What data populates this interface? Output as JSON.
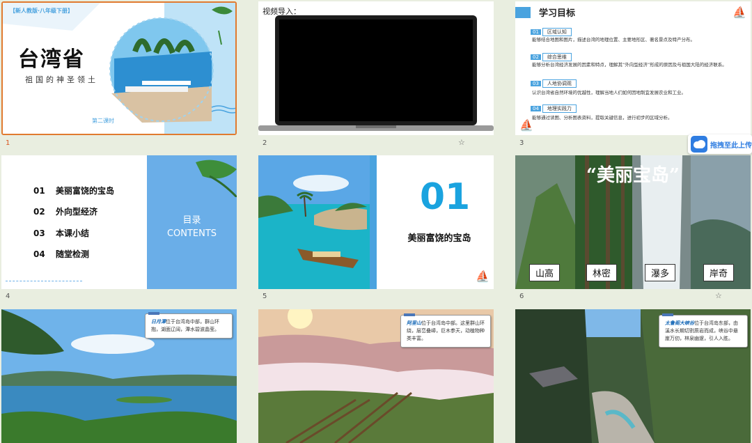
{
  "slides": [
    {
      "number": "1",
      "tag": "【新人教版·八年级下册】",
      "title": "台湾省",
      "subtitle": "祖国的神圣领土",
      "lesson": "第二课时"
    },
    {
      "number": "2",
      "label": "视频导入："
    },
    {
      "number": "3",
      "title": "学习目标",
      "items": [
        {
          "num": "01",
          "label": "区域认知",
          "desc": "能够结合地图和图片，描述台湾的地理位置、主要地形区、著名景点及特产分布。"
        },
        {
          "num": "02",
          "label": "综合思维",
          "desc": "能够分析台湾经济发展的因素和特点，理解其“外向型经济”形成的原因及与祖国大陆的经济联系。"
        },
        {
          "num": "03",
          "label": "人地协调观",
          "desc": "认识台湾省自然环境的优越性，理解当地人们如何因地制宜发展农业和工业。"
        },
        {
          "num": "04",
          "label": "地理实践力",
          "desc": "能够通过读图、分析图表资料，提取关键信息，进行初步的区域分析。"
        }
      ]
    },
    {
      "number": "4",
      "items": [
        {
          "num": "01",
          "label": "美丽富饶的宝岛"
        },
        {
          "num": "02",
          "label": "外向型经济"
        },
        {
          "num": "03",
          "label": "本课小结"
        },
        {
          "num": "04",
          "label": "随堂检测"
        }
      ],
      "toc_cn": "目录",
      "toc_en": "CONTENTS"
    },
    {
      "number": "5",
      "section_num": "01",
      "section_title": "美丽富饶的宝岛"
    },
    {
      "number": "6",
      "title": "“美丽宝岛”",
      "labels": [
        "山高",
        "林密",
        "瀑多",
        "岸奇"
      ]
    },
    {
      "number": "7",
      "caption_bold": "日月潭",
      "caption_rest": "位于台湾岛中部，群山环抱，湖面辽阔，潭水碧波晶莹。"
    },
    {
      "number": "8",
      "caption_bold": "阿里山",
      "caption_rest": "位于台湾岛中部。这里群山环绕，层峦叠嶂，巨木参天，动植物种类丰富。"
    },
    {
      "number": "9",
      "caption_bold": "太鲁阁大峡谷",
      "caption_rest": "位于台湾岛东部，由溪水长期切割质岩而成，峡谷中悬崖万仞，林泉幽邃，引人入胜。"
    }
  ],
  "upload_button": "拖拽至此上传"
}
